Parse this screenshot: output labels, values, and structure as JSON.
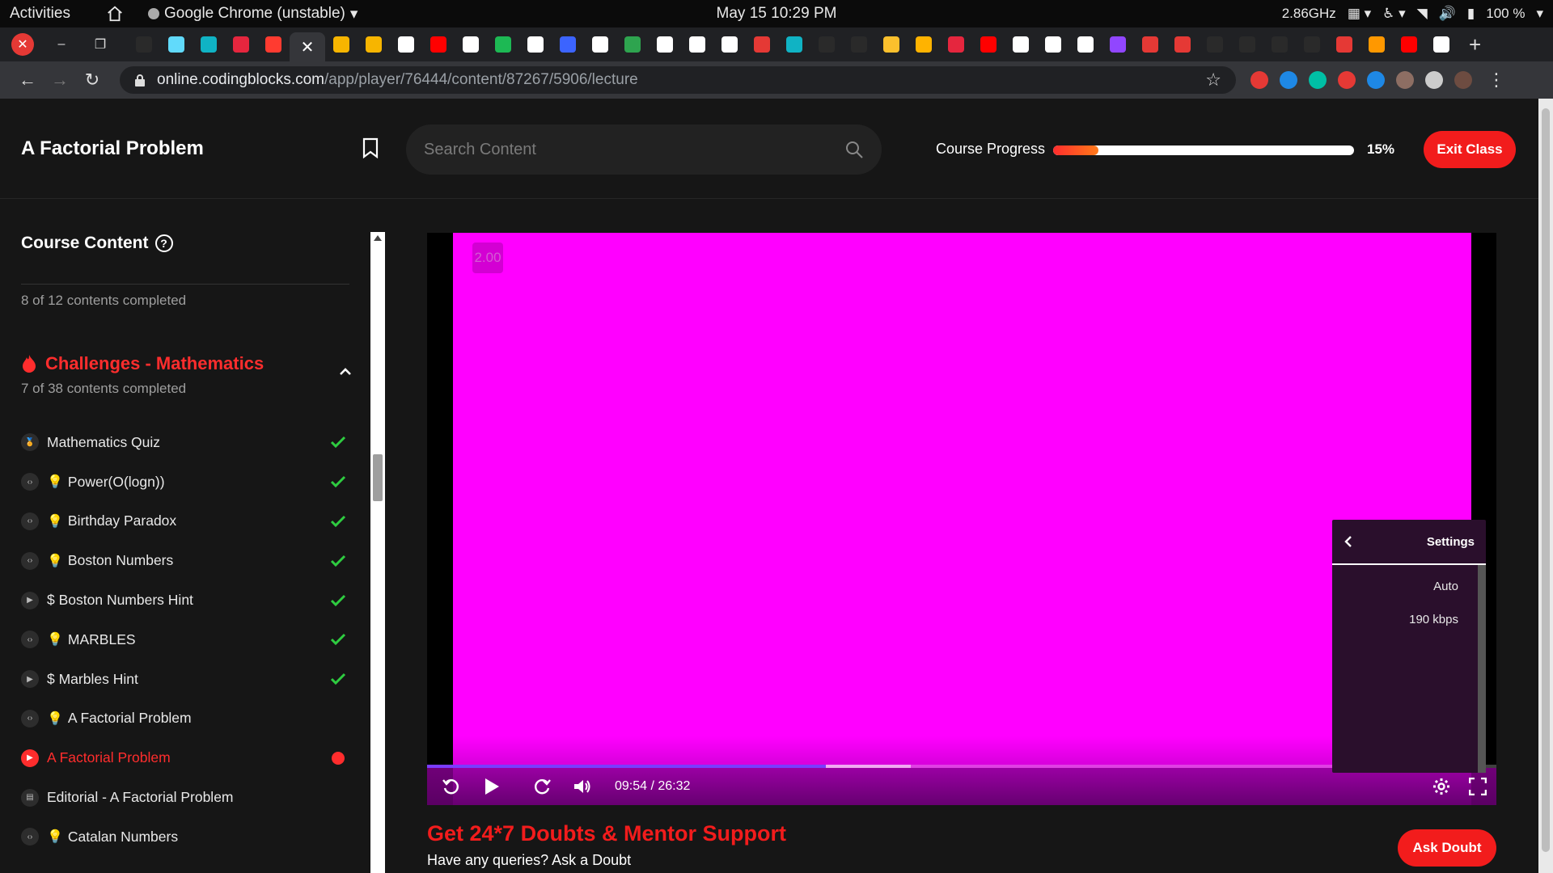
{
  "os_bar": {
    "activities": "Activities",
    "app_name": "Google Chrome (unstable)",
    "clock": "May 15  10:29 PM",
    "cpu": "2.86GHz",
    "battery": "100 %"
  },
  "browser": {
    "url_host": "online.codingblocks.com",
    "url_path": "/app/player/76444/content/87267/5906/lecture",
    "tab_favicon_colors": [
      "#2a2a2a",
      "#61dafb",
      "#10b3c4",
      "#e5263e",
      "#ff3b30",
      "#f7b500",
      "#f7b500",
      "#ffffff",
      "#ff0000",
      "#ffffff",
      "#1db954",
      "#ffffff",
      "#3c64ff",
      "#ffffff",
      "#2ea44f",
      "#ffffff",
      "#ffffff",
      "#ffffff",
      "#e53935",
      "#10b3c4",
      "#2a2a2a",
      "#2a2a2a",
      "#fbc02d",
      "#ffb300",
      "#e5263e",
      "#ff0000",
      "#ffffff",
      "#ffffff",
      "#ffffff",
      "#9146ff",
      "#e53935",
      "#e53935",
      "#2a2a2a",
      "#2a2a2a",
      "#2a2a2a",
      "#2a2a2a",
      "#e53935",
      "#ff9800",
      "#ff0000",
      "#ffffff"
    ],
    "extension_colors": [
      "#e53935",
      "#1e88e5",
      "#00bfa5",
      "#e53935",
      "#1e88e5",
      "#8d6e63",
      "#cccccc",
      "#6d4c41"
    ]
  },
  "header": {
    "lecture_title": "A Factorial Problem",
    "search_placeholder": "Search Content",
    "progress_label": "Course Progress",
    "progress_percent": "15%",
    "progress_value": 15,
    "exit_label": "Exit Class"
  },
  "sidebar": {
    "title": "Course Content",
    "help_glyph": "?",
    "prev_section_progress": "8 of 12 contents completed",
    "section_title": "Challenges - Mathematics",
    "section_progress": "7 of 38 contents completed",
    "items": [
      {
        "type": "quiz",
        "label": "Mathematics Quiz",
        "bulb": false,
        "done": true,
        "active": false
      },
      {
        "type": "code",
        "label": "Power(O(logn))",
        "bulb": true,
        "done": true,
        "active": false
      },
      {
        "type": "code",
        "label": "Birthday Paradox",
        "bulb": true,
        "done": true,
        "active": false
      },
      {
        "type": "code",
        "label": "Boston Numbers",
        "bulb": true,
        "done": true,
        "active": false
      },
      {
        "type": "video",
        "label": "$ Boston Numbers Hint",
        "bulb": false,
        "done": true,
        "active": false
      },
      {
        "type": "code",
        "label": "MARBLES",
        "bulb": true,
        "done": true,
        "active": false
      },
      {
        "type": "video",
        "label": "$ Marbles Hint",
        "bulb": false,
        "done": true,
        "active": false
      },
      {
        "type": "code",
        "label": "A Factorial Problem",
        "bulb": true,
        "done": false,
        "active": false
      },
      {
        "type": "video",
        "label": "A Factorial Problem",
        "bulb": false,
        "done": false,
        "active": true
      },
      {
        "type": "doc",
        "label": "Editorial - A Factorial Problem",
        "bulb": false,
        "done": false,
        "active": false
      },
      {
        "type": "code",
        "label": "Catalan Numbers",
        "bulb": true,
        "done": false,
        "active": false
      }
    ]
  },
  "player": {
    "speed": "2.00",
    "time": "09:54 / 26:32",
    "played_fraction": 0.373,
    "buffered_fraction": 0.452,
    "settings_title": "Settings",
    "quality_options": [
      "Auto",
      "190 kbps"
    ]
  },
  "doubt": {
    "title": "Get 24*7 Doubts & Mentor Support",
    "subtitle": "Have any queries? Ask a Doubt",
    "button": "Ask Doubt"
  },
  "colors": {
    "accent": "#f21c1c",
    "check": "#2ecc40",
    "video": "#ff00ff"
  }
}
